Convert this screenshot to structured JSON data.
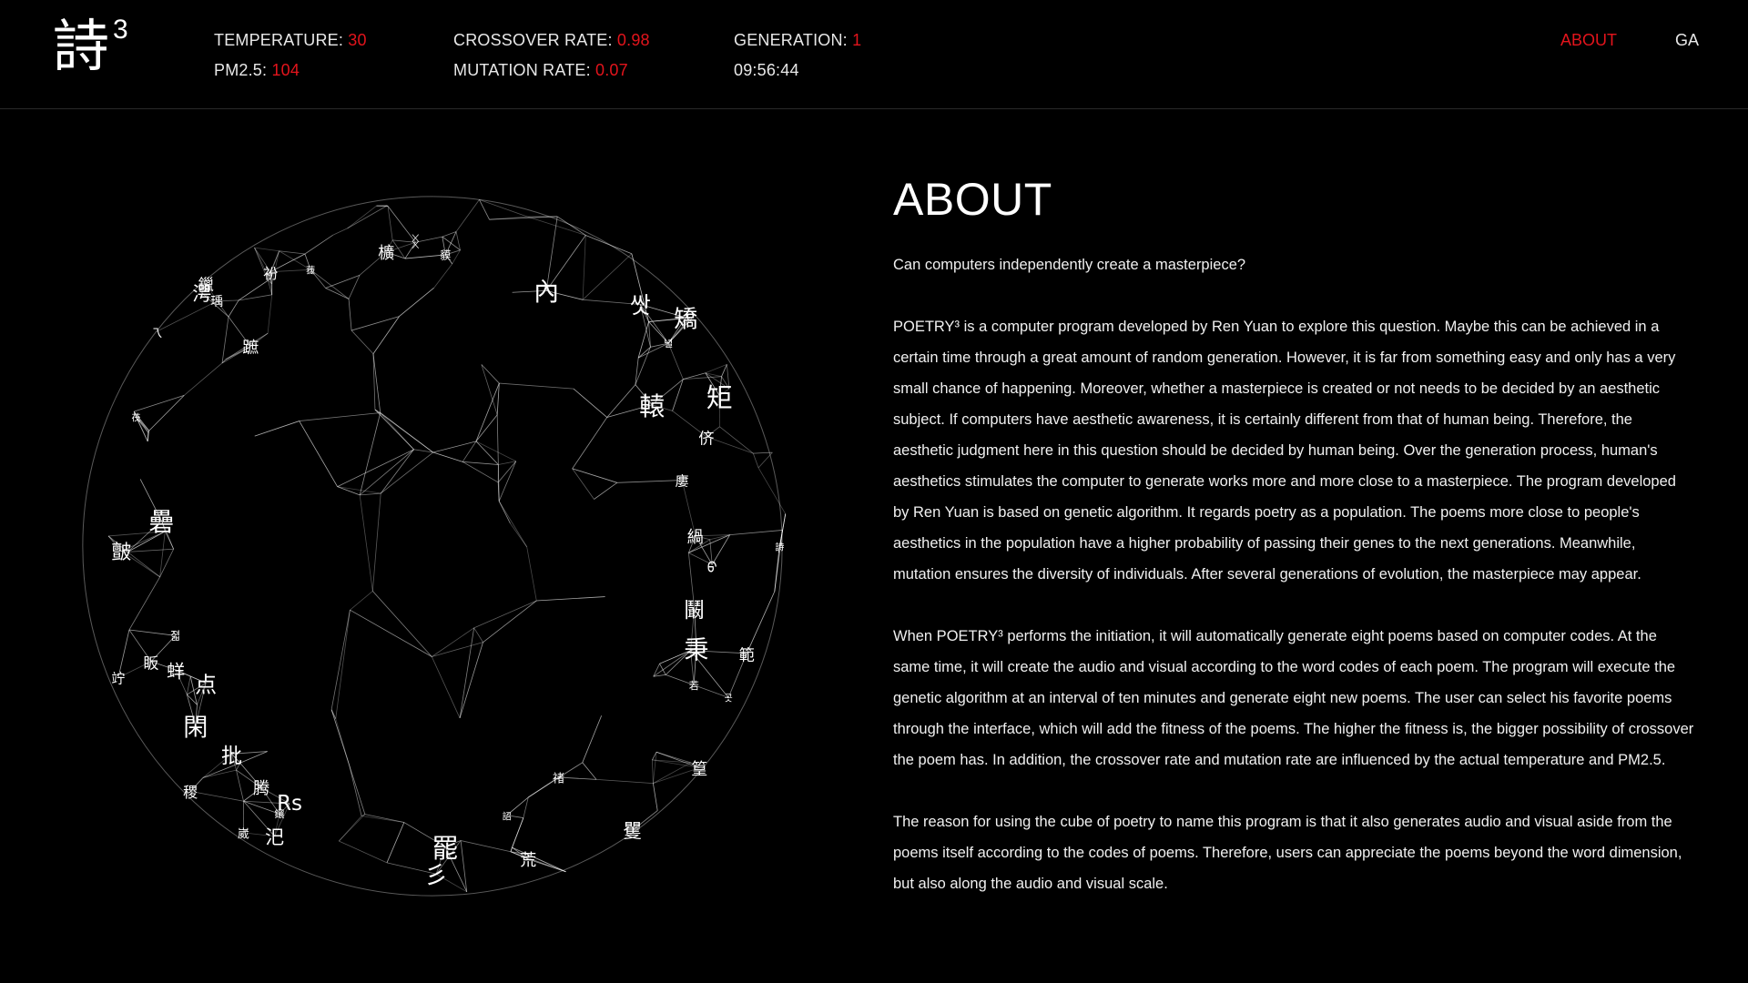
{
  "header": {
    "logo_text": "詩",
    "logo_sup": "3",
    "stats": [
      {
        "label": "TEMPERATURE:",
        "value": "30"
      },
      {
        "label": "PM2.5:",
        "value": "104"
      },
      {
        "label": "CROSSOVER RATE:",
        "value": "0.98"
      },
      {
        "label": "MUTATION RATE:",
        "value": "0.07"
      },
      {
        "label": "GENERATION:",
        "value": "1"
      }
    ],
    "clock": "09:56:44",
    "nav": [
      {
        "label": "ABOUT",
        "active": true
      },
      {
        "label": "GA",
        "active": false
      }
    ]
  },
  "visual": {
    "glyphs": [
      "詩",
      "汜",
      "內",
      "蓵",
      "矩",
      "批",
      "蛘",
      "秉",
      "轅",
      "礨",
      "鑲",
      "쌋",
      "侪",
      "Rs",
      "若",
      "蹠",
      "Ç",
      "ᠪ",
      "ᛝ",
      "稷",
      "鑞",
      "茷",
      "範",
      "篁",
      "矯",
      "彡",
      "녈",
      "櫎",
      "湂",
      "皽",
      "졃",
      "貘",
      "荒",
      "곳",
      "廔",
      "鬫",
      "乁",
      "罷",
      "閑",
      "矍",
      "禇",
      "緺",
      "点",
      "竚",
      "腾",
      "衯",
      "眅",
      "崴",
      "詔",
      "瑀"
    ]
  },
  "about": {
    "title": "ABOUT",
    "paragraphs": [
      "Can computers independently create a masterpiece?",
      "POETRY³ is a computer program developed by Ren Yuan to explore this question. Maybe this can be achieved in a certain time through a great amount of random generation. However, it is far from something easy and only has a very small chance of happening. Moreover, whether a masterpiece is created or not needs to be decided by an aesthetic subject. If computers have aesthetic awareness, it is certainly different from that of human being. Therefore, the aesthetic judgment here in this question should be decided by human being. Over the generation process, human's aesthetics stimulates the computer to generate works more and more close to a masterpiece. The program developed by Ren Yuan is based on genetic algorithm. It regards poetry as a population. The poems more close to people's aesthetics in the population have a higher probability of passing their genes to the next generations. Meanwhile, mutation ensures the diversity of individuals. After several generations of evolution, the masterpiece may appear.",
      "When POETRY³ performs the initiation, it will automatically generate eight poems based on computer codes. At the same time, it will create the audio and visual according to the word codes of each poem. The program will execute the genetic algorithm at an interval of ten minutes and generate eight new poems. The user can select his favorite poems through the interface, which will add the fitness of the poems. The higher the fitness is, the bigger possibility of crossover the poem has. In addition, the crossover rate and mutation rate are influenced by the actual temperature and PM2.5.",
      "The reason for using the cube of poetry to name this program is that it also generates audio and visual aside from the poems itself according to the codes of poems. Therefore, users can appreciate the poems beyond the word dimension, but also along the audio and visual scale."
    ]
  },
  "colors": {
    "accent": "#e3141c",
    "background": "#000000",
    "text": "#ffffff"
  }
}
